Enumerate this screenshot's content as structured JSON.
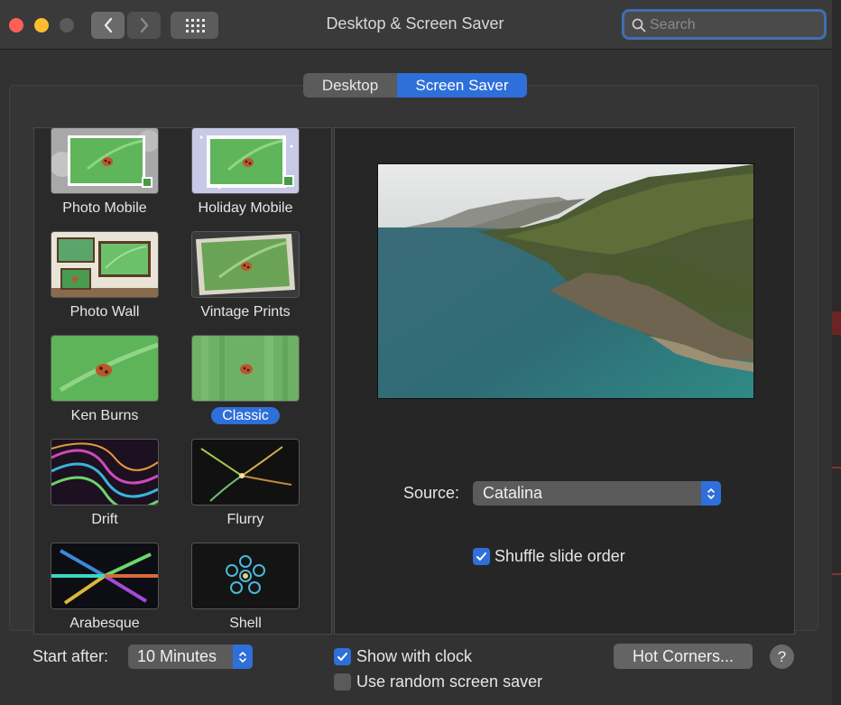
{
  "window": {
    "title": "Desktop & Screen Saver"
  },
  "search": {
    "placeholder": "Search"
  },
  "tabs": [
    {
      "label": "Desktop",
      "selected": false
    },
    {
      "label": "Screen Saver",
      "selected": true
    }
  ],
  "savers": [
    {
      "name": "Photo Mobile",
      "icon": "photo-mobile-thumbnail"
    },
    {
      "name": "Holiday Mobile",
      "icon": "holiday-mobile-thumbnail"
    },
    {
      "name": "Photo Wall",
      "icon": "photo-wall-thumbnail"
    },
    {
      "name": "Vintage Prints",
      "icon": "vintage-prints-thumbnail"
    },
    {
      "name": "Ken Burns",
      "icon": "ken-burns-thumbnail"
    },
    {
      "name": "Classic",
      "icon": "classic-thumbnail",
      "selected": true
    },
    {
      "name": "Drift",
      "icon": "drift-thumbnail"
    },
    {
      "name": "Flurry",
      "icon": "flurry-thumbnail"
    },
    {
      "name": "Arabesque",
      "icon": "arabesque-thumbnail"
    },
    {
      "name": "Shell",
      "icon": "shell-thumbnail"
    }
  ],
  "preview": {
    "image": "coastline-cliffs-photo"
  },
  "options": {
    "source_label": "Source:",
    "source_value": "Catalina",
    "shuffle_label": "Shuffle slide order",
    "shuffle_checked": true
  },
  "footer": {
    "start_after_label": "Start after:",
    "start_after_value": "10 Minutes",
    "show_clock_label": "Show with clock",
    "show_clock_checked": true,
    "random_label": "Use random screen saver",
    "random_checked": false,
    "hot_corners_label": "Hot Corners...",
    "help_label": "?"
  },
  "colors": {
    "accent": "#2f6fd9",
    "window_bg": "#323232"
  }
}
